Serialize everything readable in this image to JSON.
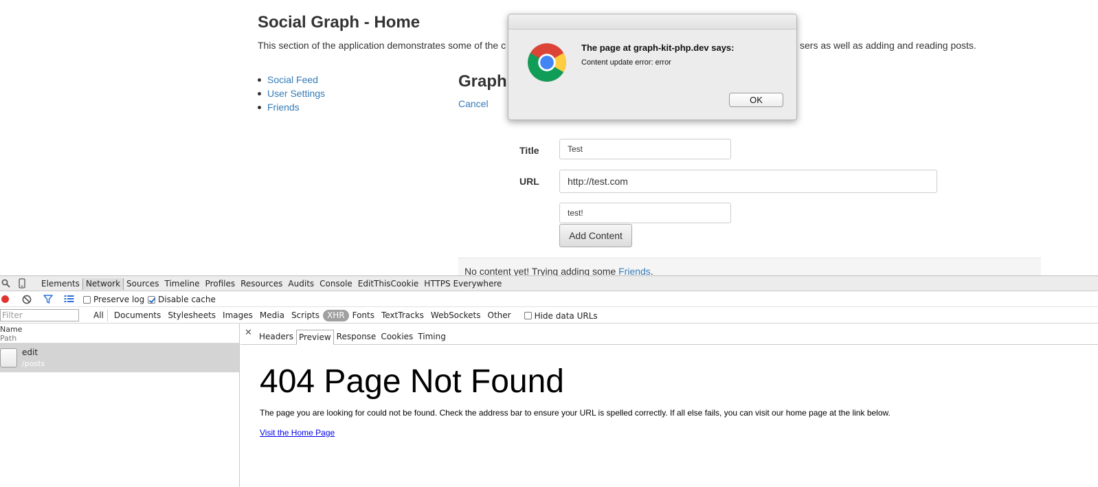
{
  "page": {
    "title": "Social Graph - Home",
    "intro": "This section of the application demonstrates some of the c",
    "intro_tail": "sers as well as adding and reading posts.",
    "nav": [
      {
        "label": "Social Feed"
      },
      {
        "label": "User Settings"
      },
      {
        "label": "Friends"
      }
    ],
    "section_heading": "Graph",
    "cancel_label": "Cancel",
    "form": {
      "title_label": "Title",
      "title_value": "Test",
      "url_label": "URL",
      "url_value": "http://test.com",
      "text_value": "test!",
      "add_button": "Add Content"
    },
    "feed": {
      "empty_prefix": "No content yet! Trying adding some ",
      "empty_link": "Friends",
      "empty_suffix": "."
    }
  },
  "dialog": {
    "heading": "The page at graph-kit-php.dev says:",
    "message": "Content update error: error",
    "ok_label": "OK"
  },
  "devtools": {
    "tabs": [
      "Elements",
      "Network",
      "Sources",
      "Timeline",
      "Profiles",
      "Resources",
      "Audits",
      "Console",
      "EditThisCookie",
      "HTTPS Everywhere"
    ],
    "active_tab": "Network",
    "preserve_log_label": "Preserve log",
    "preserve_log_checked": false,
    "disable_cache_label": "Disable cache",
    "disable_cache_checked": true,
    "filter_placeholder": "Filter",
    "type_filters": [
      "All",
      "Documents",
      "Stylesheets",
      "Images",
      "Media",
      "Scripts",
      "XHR",
      "Fonts",
      "TextTracks",
      "WebSockets",
      "Other"
    ],
    "active_type_filter": "XHR",
    "hide_data_urls_label": "Hide data URLs",
    "hide_data_urls_checked": false,
    "list_header_name": "Name",
    "list_header_path": "Path",
    "request": {
      "name": "edit",
      "path": "/posts"
    },
    "detail_tabs": [
      "Headers",
      "Preview",
      "Response",
      "Cookies",
      "Timing"
    ],
    "active_detail_tab": "Preview",
    "preview": {
      "heading": "404 Page Not Found",
      "text": "The page you are looking for could not be found. Check the address bar to ensure your URL is spelled correctly. If all else fails, you can visit our home page at the link below.",
      "link": "Visit the Home Page"
    }
  },
  "colors": {
    "link": "#337ab7",
    "record_red": "#e0322e",
    "xhr_pill": "#a0a0a0",
    "selected_row": "#d4d4d4"
  }
}
